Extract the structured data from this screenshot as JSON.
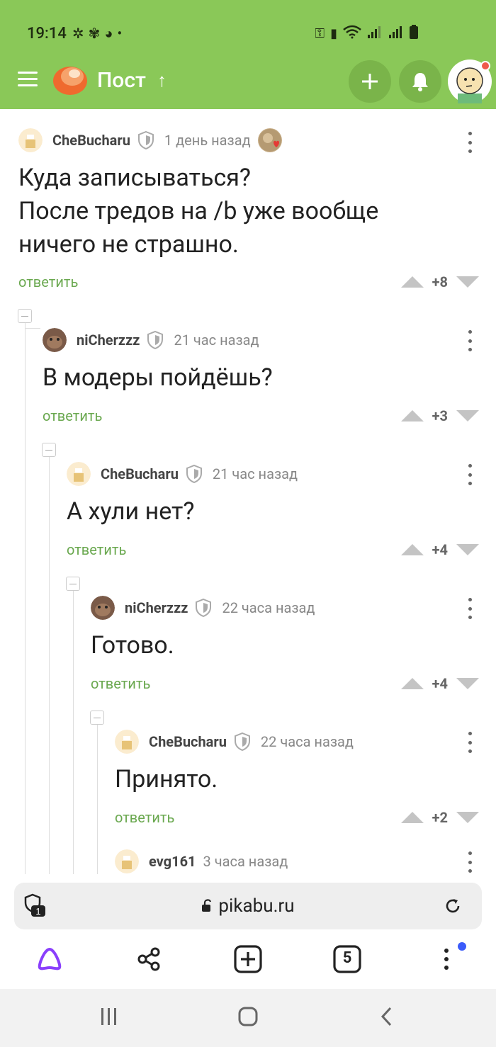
{
  "status_bar": {
    "time": "19:14"
  },
  "header": {
    "title": "Пост"
  },
  "comments": [
    {
      "author": "CheBucharu",
      "time": "1 день назад",
      "text_lines": [
        "Куда записываться?",
        "После тредов на  /b уже вообще",
        "ничего не страшно."
      ],
      "reply": "ответить",
      "score": "+8"
    },
    {
      "author": "niCherzzz",
      "time": "21 час назад",
      "text": "В модеры пойдёшь?",
      "reply": "ответить",
      "score": "+3"
    },
    {
      "author": "CheBucharu",
      "time": "21 час назад",
      "text": "А хули нет?",
      "reply": "ответить",
      "score": "+4"
    },
    {
      "author": "niCherzzz",
      "time": "22 часа назад",
      "text": "Готово.",
      "reply": "ответить",
      "score": "+4"
    },
    {
      "author": "CheBucharu",
      "time": "22 часа назад",
      "text": "Принято.",
      "reply": "ответить",
      "score": "+2"
    },
    {
      "author": "evg161",
      "time": "3 часа назад"
    }
  ],
  "browser": {
    "url": "pikabu.ru",
    "tab_count": "5",
    "shield_count": "1"
  },
  "colors": {
    "header": "#8ac858",
    "reply": "#6aa84f",
    "alice": "#8a3ffc"
  }
}
